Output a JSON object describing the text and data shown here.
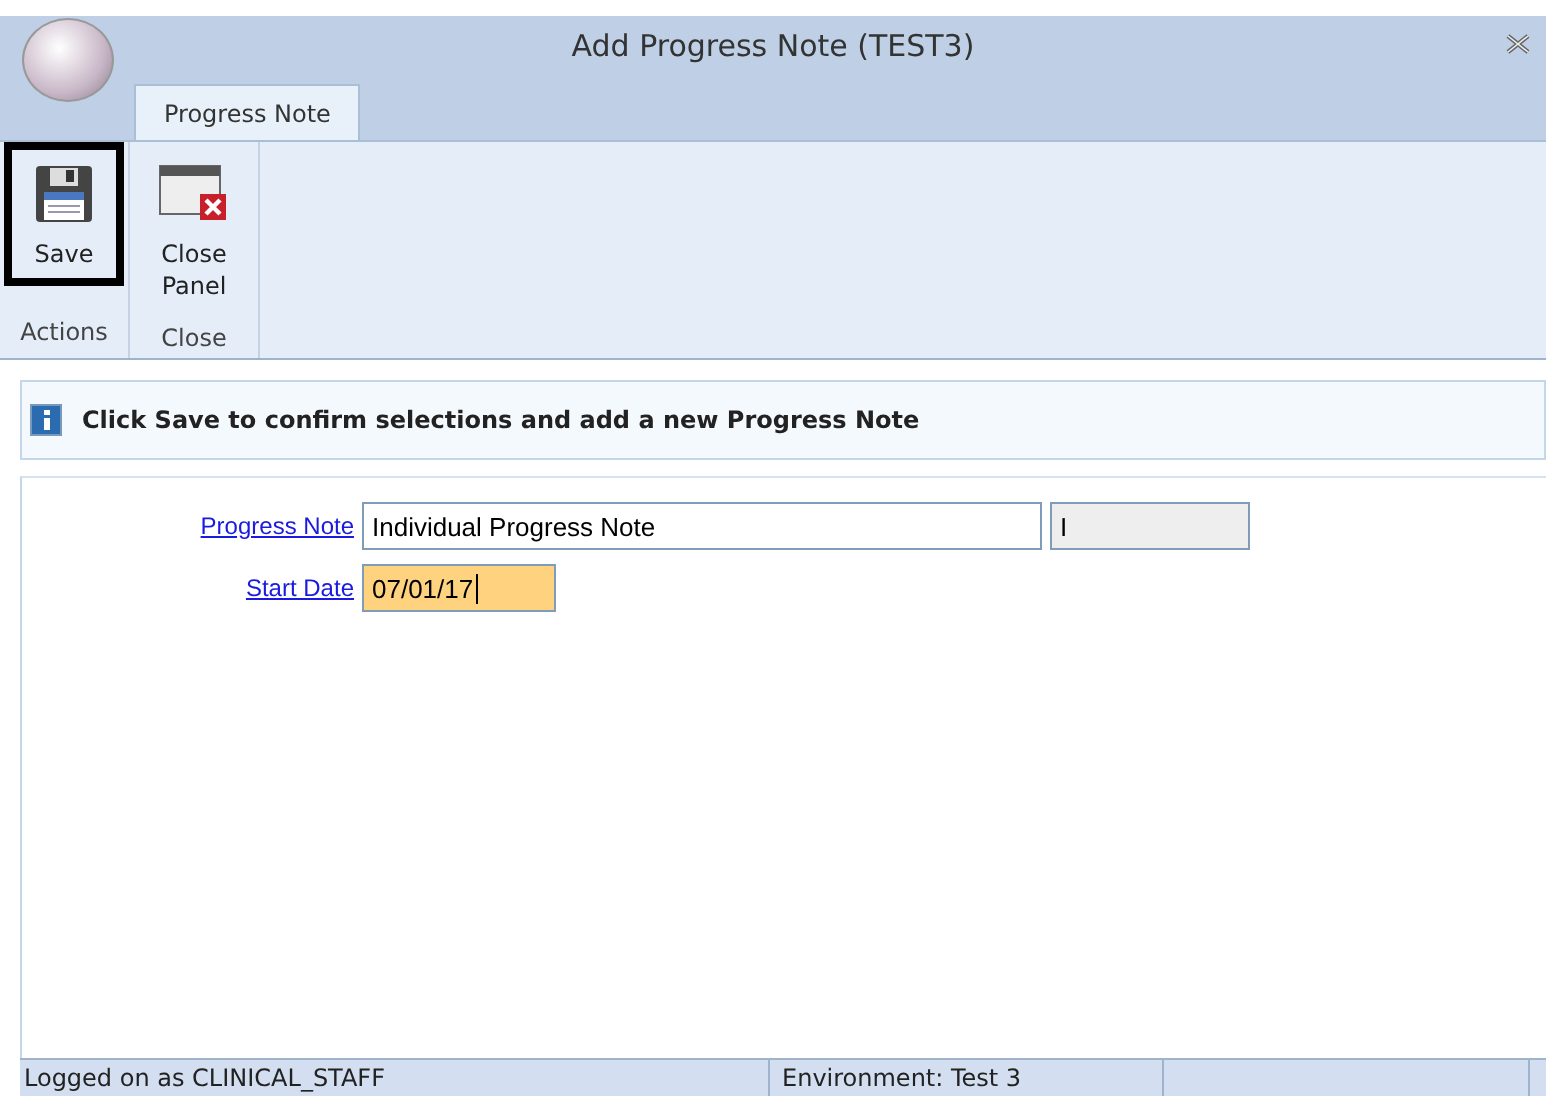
{
  "window": {
    "title": "Add Progress Note (TEST3)"
  },
  "tabs": [
    {
      "label": "Progress Note",
      "selected": true
    }
  ],
  "ribbon_groups": [
    {
      "label": "Actions",
      "buttons": [
        {
          "kind": "save",
          "label": "Save",
          "selected": true
        }
      ]
    },
    {
      "label": "Close",
      "buttons": [
        {
          "kind": "close",
          "label": "Close Panel",
          "selected": false
        }
      ]
    }
  ],
  "info_bar": {
    "text": "Click Save to confirm selections and add a new Progress Note"
  },
  "form": [
    {
      "label": "Progress Note",
      "value": "Individual Progress Note",
      "extra": "I",
      "highlighted": false,
      "focused": false
    },
    {
      "label": "Start Date",
      "value": "07/01/17",
      "highlighted": true,
      "focused": true
    }
  ],
  "status_bar": [
    "Logged on as CLINICAL_STAFF",
    "Environment: Test 3"
  ]
}
